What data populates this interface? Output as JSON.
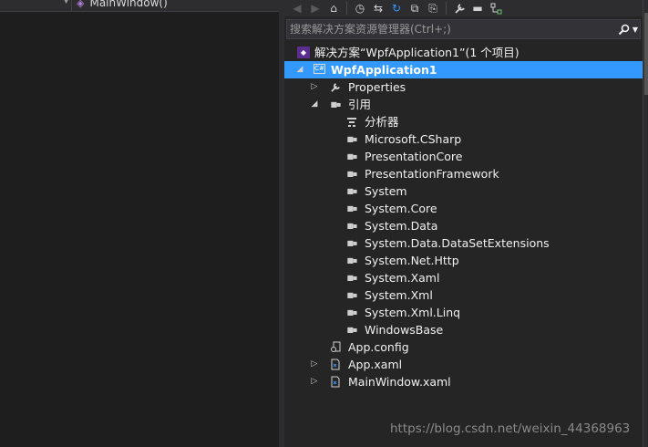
{
  "editor": {
    "method_name": "MainWindow()"
  },
  "toolbar": {
    "buttons": [
      {
        "name": "back-icon",
        "glyph": "◀"
      },
      {
        "name": "forward-icon",
        "glyph": "▶"
      },
      {
        "name": "home-icon",
        "glyph": "⌂"
      },
      {
        "name": "pending-changes-icon",
        "glyph": "◷"
      },
      {
        "name": "sync-icon",
        "glyph": "⇆"
      },
      {
        "name": "refresh-icon",
        "glyph": "↻"
      },
      {
        "name": "collapse-all-icon",
        "glyph": "⧉"
      },
      {
        "name": "show-all-files-icon",
        "glyph": "⎘"
      },
      {
        "name": "properties-icon",
        "glyph": "🔧"
      },
      {
        "name": "preview-icon",
        "glyph": "▬"
      },
      {
        "name": "class-diagram-icon",
        "glyph": "⚭"
      }
    ]
  },
  "search": {
    "placeholder": "搜索解决方案资源管理器(Ctrl+;)",
    "icon": "search-icon"
  },
  "tree": {
    "solution": {
      "label": "解决方案“WpfApplication1”(1 个项目)",
      "icon": "solution-icon"
    },
    "project": {
      "label": "WpfApplication1",
      "icon": "csharp-project-icon",
      "expanded": true,
      "selected": true
    },
    "properties": {
      "label": "Properties",
      "icon": "wrench-icon",
      "expanded": false
    },
    "references": {
      "label": "引用",
      "icon": "references-icon",
      "expanded": true,
      "items": [
        {
          "label": "分析器",
          "icon": "analyzer-icon"
        },
        {
          "label": "Microsoft.CSharp",
          "icon": "reference-icon"
        },
        {
          "label": "PresentationCore",
          "icon": "reference-icon"
        },
        {
          "label": "PresentationFramework",
          "icon": "reference-icon"
        },
        {
          "label": "System",
          "icon": "reference-icon"
        },
        {
          "label": "System.Core",
          "icon": "reference-icon"
        },
        {
          "label": "System.Data",
          "icon": "reference-icon"
        },
        {
          "label": "System.Data.DataSetExtensions",
          "icon": "reference-icon"
        },
        {
          "label": "System.Net.Http",
          "icon": "reference-icon"
        },
        {
          "label": "System.Xaml",
          "icon": "reference-icon"
        },
        {
          "label": "System.Xml",
          "icon": "reference-icon"
        },
        {
          "label": "System.Xml.Linq",
          "icon": "reference-icon"
        },
        {
          "label": "WindowsBase",
          "icon": "reference-icon"
        }
      ]
    },
    "files": [
      {
        "label": "App.config",
        "icon": "config-file-icon",
        "expandable": false
      },
      {
        "label": "App.xaml",
        "icon": "xaml-file-icon",
        "expandable": true
      },
      {
        "label": "MainWindow.xaml",
        "icon": "xaml-file-icon",
        "expandable": true
      }
    ]
  },
  "watermark": "https://blog.csdn.net/weixin_44368963"
}
